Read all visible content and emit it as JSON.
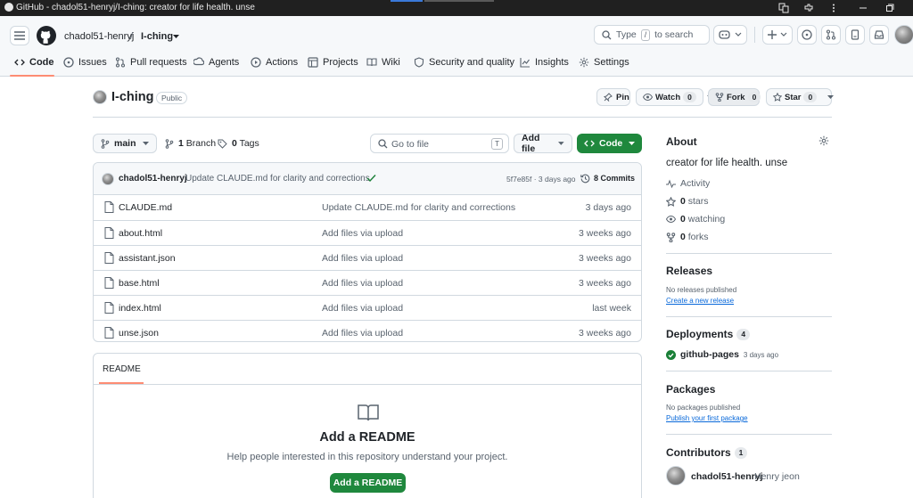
{
  "window": {
    "title": "GitHub - chadol51-henryj/I-ching: creator for life health. unse"
  },
  "header": {
    "owner": "chadol51-henryj",
    "separator": "/",
    "repo": "I-ching",
    "search_prefix": "Type",
    "search_key": "/",
    "search_suffix": "to search",
    "add_label": "+"
  },
  "tabs": [
    {
      "label": "Code",
      "icon": "code-icon"
    },
    {
      "label": "Issues",
      "icon": "issue-icon"
    },
    {
      "label": "Pull requests",
      "icon": "pull-request-icon"
    },
    {
      "label": "Agents",
      "icon": "agents-icon"
    },
    {
      "label": "Actions",
      "icon": "play-icon"
    },
    {
      "label": "Projects",
      "icon": "table-icon"
    },
    {
      "label": "Wiki",
      "icon": "book-icon"
    },
    {
      "label": "Security and quality",
      "icon": "shield-icon"
    },
    {
      "label": "Insights",
      "icon": "graph-icon"
    },
    {
      "label": "Settings",
      "icon": "gear-icon"
    }
  ],
  "repo": {
    "name": "I-ching",
    "visibility": "Public",
    "pin_label": "Pin",
    "watch_label": "Watch",
    "watch_count": "0",
    "fork_label": "Fork",
    "fork_count": "0",
    "star_label": "Star",
    "star_count": "0"
  },
  "toolbar": {
    "branch": "main",
    "branch_count": "1",
    "branch_label": "Branch",
    "tag_count": "0",
    "tag_label": "Tags",
    "goto_placeholder": "Go to file",
    "goto_key": "T",
    "add_file": "Add file",
    "code": "Code"
  },
  "commit": {
    "author": "chadol51-henryj",
    "message": "Update CLAUDE.md for clarity and corrections",
    "hash_age": "5f7e85f · 3 days ago",
    "commits": "8 Commits"
  },
  "files": [
    {
      "name": "CLAUDE.md",
      "message": "Update CLAUDE.md for clarity and corrections",
      "age": "3 days ago"
    },
    {
      "name": "about.html",
      "message": "Add files via upload",
      "age": "3 weeks ago"
    },
    {
      "name": "assistant.json",
      "message": "Add files via upload",
      "age": "3 weeks ago"
    },
    {
      "name": "base.html",
      "message": "Add files via upload",
      "age": "3 weeks ago"
    },
    {
      "name": "index.html",
      "message": "Add files via upload",
      "age": "last week"
    },
    {
      "name": "unse.json",
      "message": "Add files via upload",
      "age": "3 weeks ago"
    }
  ],
  "readme": {
    "tab": "README",
    "title": "Add a README",
    "subtitle": "Help people interested in this repository understand your project.",
    "button": "Add a README"
  },
  "sidebar": {
    "about": "About",
    "description": "creator for life health. unse",
    "activity": "Activity",
    "stars_count": "0",
    "stars_label": "stars",
    "watching_count": "0",
    "watching_label": "watching",
    "forks_count": "0",
    "forks_label": "forks",
    "releases": "Releases",
    "no_releases": "No releases published",
    "create_release": "Create a new release",
    "deployments": "Deployments",
    "deployments_count": "4",
    "deployment_name": "github-pages",
    "deployment_age": "3 days ago",
    "packages": "Packages",
    "no_packages": "No packages published",
    "publish_package": "Publish your first package",
    "contributors": "Contributors",
    "contributors_count": "1",
    "contributor_login": "chadol51-henryj",
    "contributor_name": "Henry jeon"
  },
  "colors": {
    "accent": "#1f883d",
    "tab_underline": "#fd8c73",
    "link": "#0969da"
  }
}
